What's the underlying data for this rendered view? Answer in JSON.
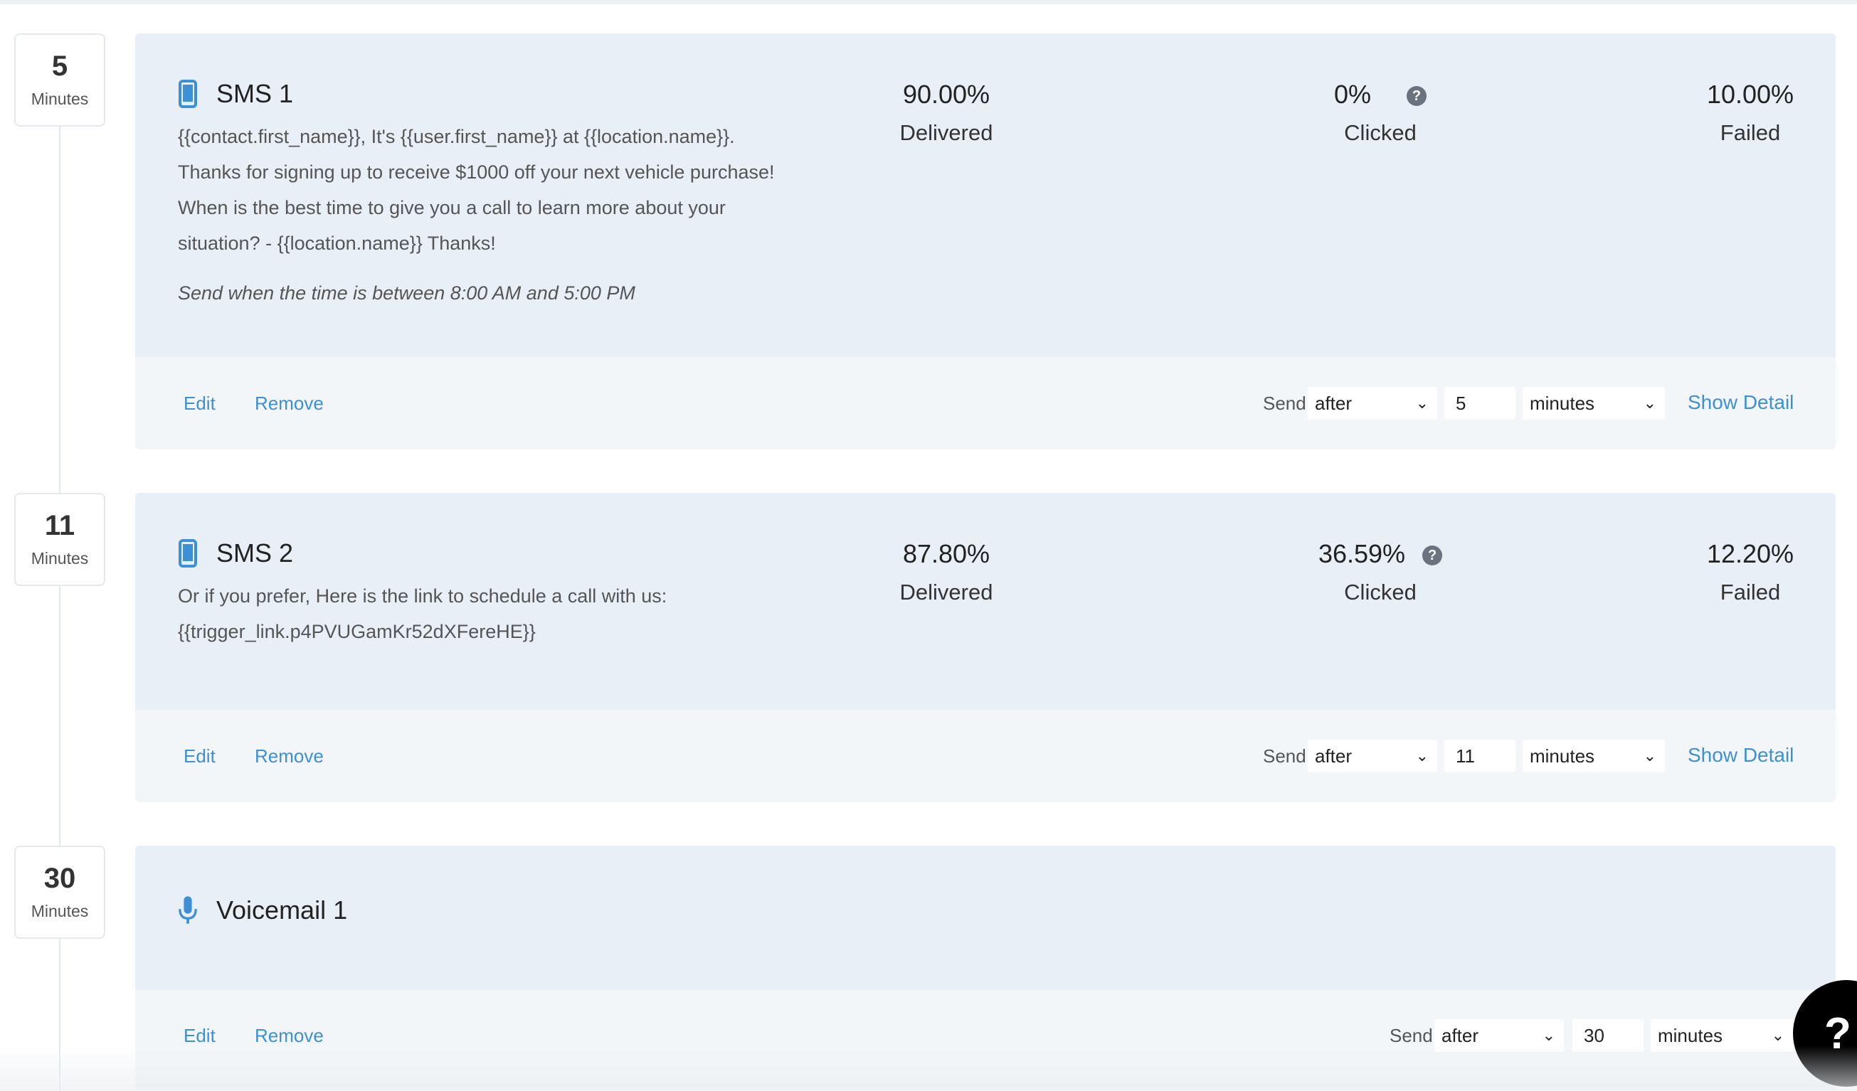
{
  "steps": [
    {
      "delay": {
        "number": "5",
        "unit": "Minutes"
      },
      "type_icon": "mobile-phone-icon",
      "title": "SMS 1",
      "message_lines": [
        "{{contact.first_name}}, It's {{user.first_name}} at {{location.name}}.",
        "Thanks for signing up to receive $1000 off your next vehicle purchase!",
        "When is the best time to give you a call to learn more about your",
        "situation?  - {{location.name}}   Thanks!"
      ],
      "send_window": "Send when the time is between 8:00 AM and 5:00 PM",
      "stats": {
        "delivered": {
          "value": "90.00%",
          "label": "Delivered"
        },
        "clicked": {
          "value": "0%",
          "label": "Clicked"
        },
        "failed": {
          "value": "10.00%",
          "label": "Failed"
        }
      },
      "actions": {
        "edit": "Edit",
        "remove": "Remove",
        "send_label": "Send",
        "timing": "after",
        "amount": "5",
        "unit": "minutes",
        "show_detail": "Show Detail"
      }
    },
    {
      "delay": {
        "number": "11",
        "unit": "Minutes"
      },
      "type_icon": "mobile-phone-icon",
      "title": "SMS 2",
      "message_lines": [
        "Or if you prefer, Here is the link to schedule a call with us:",
        "{{trigger_link.p4PVUGamKr52dXFereHE}}"
      ],
      "stats": {
        "delivered": {
          "value": "87.80%",
          "label": "Delivered"
        },
        "clicked": {
          "value": "36.59%",
          "label": "Clicked"
        },
        "failed": {
          "value": "12.20%",
          "label": "Failed"
        }
      },
      "actions": {
        "edit": "Edit",
        "remove": "Remove",
        "send_label": "Send",
        "timing": "after",
        "amount": "11",
        "unit": "minutes",
        "show_detail": "Show Detail"
      }
    },
    {
      "delay": {
        "number": "30",
        "unit": "Minutes"
      },
      "type_icon": "microphone-icon",
      "title": "Voicemail 1",
      "actions": {
        "edit": "Edit",
        "remove": "Remove",
        "send_label": "Send",
        "timing": "after",
        "amount": "30",
        "unit": "minutes"
      }
    }
  ],
  "help_button": "?",
  "help_tooltip_glyph": "?",
  "select_arrow_glyph": "⌄",
  "colors": {
    "accent_link": "#3d8fd6",
    "card_top": "#e8eff6",
    "card_bottom": "#f3f6f9",
    "icon_blue": "#3d8fd6"
  }
}
